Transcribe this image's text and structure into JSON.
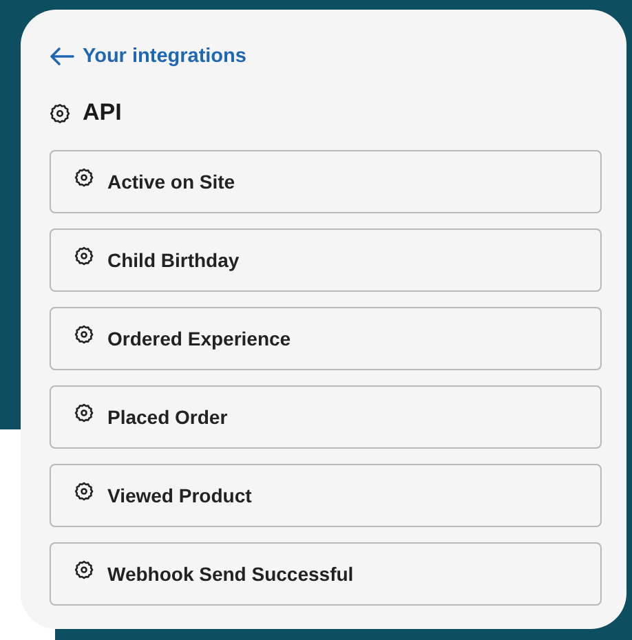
{
  "back_link": {
    "label": "Your integrations"
  },
  "heading": {
    "title": "API"
  },
  "items": [
    {
      "label": "Active on Site"
    },
    {
      "label": "Child Birthday"
    },
    {
      "label": "Ordered Experience"
    },
    {
      "label": "Placed Order"
    },
    {
      "label": "Viewed Product"
    },
    {
      "label": "Webhook Send Successful"
    }
  ]
}
